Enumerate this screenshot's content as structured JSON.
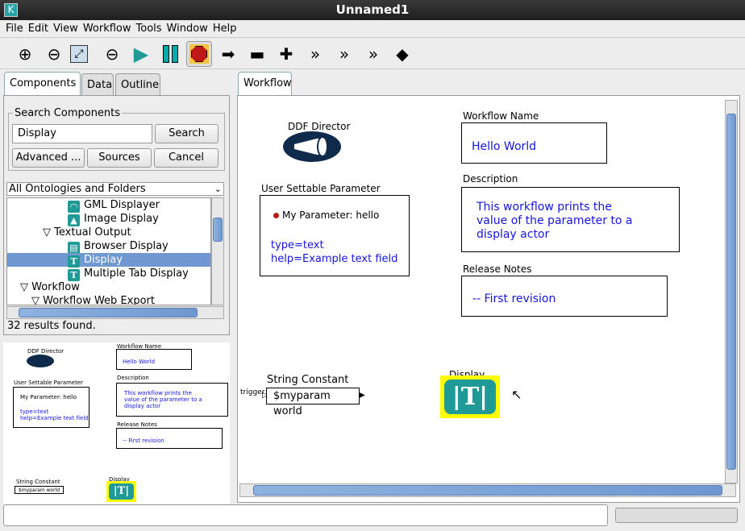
{
  "window": {
    "title": "Unnamed1",
    "logo": "K"
  },
  "menu": [
    "File",
    "Edit",
    "View",
    "Workflow",
    "Tools",
    "Window",
    "Help"
  ],
  "toolbar": [
    {
      "icon": "zoom-in-icon",
      "glyph": "⊕"
    },
    {
      "icon": "zoom-reset-icon",
      "glyph": "⊖"
    },
    {
      "icon": "zoom-fit-icon",
      "glyph": "⤢"
    },
    {
      "icon": "zoom-out-icon",
      "glyph": "⊖"
    },
    {
      "icon": "run-icon",
      "glyph": "▶"
    },
    {
      "icon": "pause-icon",
      "glyph": "❚❚"
    },
    {
      "icon": "stop-icon",
      "glyph": "⯃"
    },
    {
      "icon": "port-output-icon",
      "glyph": "➡"
    },
    {
      "icon": "port-input-icon",
      "glyph": "▬"
    },
    {
      "icon": "port-io-icon",
      "glyph": "✚"
    },
    {
      "icon": "multiport-output-icon",
      "glyph": "»"
    },
    {
      "icon": "multiport-input-icon",
      "glyph": "»"
    },
    {
      "icon": "multiport-io-icon",
      "glyph": "»"
    },
    {
      "icon": "relation-icon",
      "glyph": "◆"
    }
  ],
  "left_tabs": [
    "Components",
    "Data",
    "Outline"
  ],
  "search": {
    "group_label": "Search Components",
    "value": "Display",
    "search_label": "Search",
    "advanced_label": "Advanced ...",
    "sources_label": "Sources",
    "cancel_label": "Cancel"
  },
  "ontology_select": "All Ontologies and Folders",
  "tree": [
    {
      "label": "GML Displayer",
      "type": "item",
      "depth": 3,
      "glyph": "◠"
    },
    {
      "label": "Image Display",
      "type": "item",
      "depth": 3,
      "glyph": "▲"
    },
    {
      "label": "Textual Output",
      "type": "folder",
      "depth": 2
    },
    {
      "label": "Browser Display",
      "type": "item",
      "depth": 3,
      "glyph": "▤"
    },
    {
      "label": "Display",
      "type": "item",
      "depth": 3,
      "glyph": "T",
      "selected": true
    },
    {
      "label": "Multiple Tab Display",
      "type": "item",
      "depth": 3,
      "glyph": "T"
    },
    {
      "label": "Workflow",
      "type": "folder",
      "depth": 1
    },
    {
      "label": "Workflow Web Export",
      "type": "folder",
      "depth": 1.5
    }
  ],
  "results": "32 results found.",
  "workflow_tab": "Workflow",
  "canvas": {
    "director": "DDF Director",
    "param_title": "User Settable Parameter",
    "param_line": "My Parameter: hello",
    "param_type": "type=text",
    "param_help": "help=Example text field",
    "wf_name_title": "Workflow Name",
    "wf_name": "Hello World",
    "desc_title": "Description",
    "desc_lines": [
      "This workflow prints the",
      "value of the parameter to a",
      "display actor"
    ],
    "notes_title": "Release Notes",
    "notes": "-- First revision",
    "const_title": "String Constant",
    "const_port": "trigger",
    "const_value": "$myparam world",
    "display_title": "Display"
  },
  "colors": {
    "accent": "#1f9a96",
    "selection": "#6f98d0",
    "annotation_text": "#1515e0",
    "highlight": "#ffff00"
  }
}
